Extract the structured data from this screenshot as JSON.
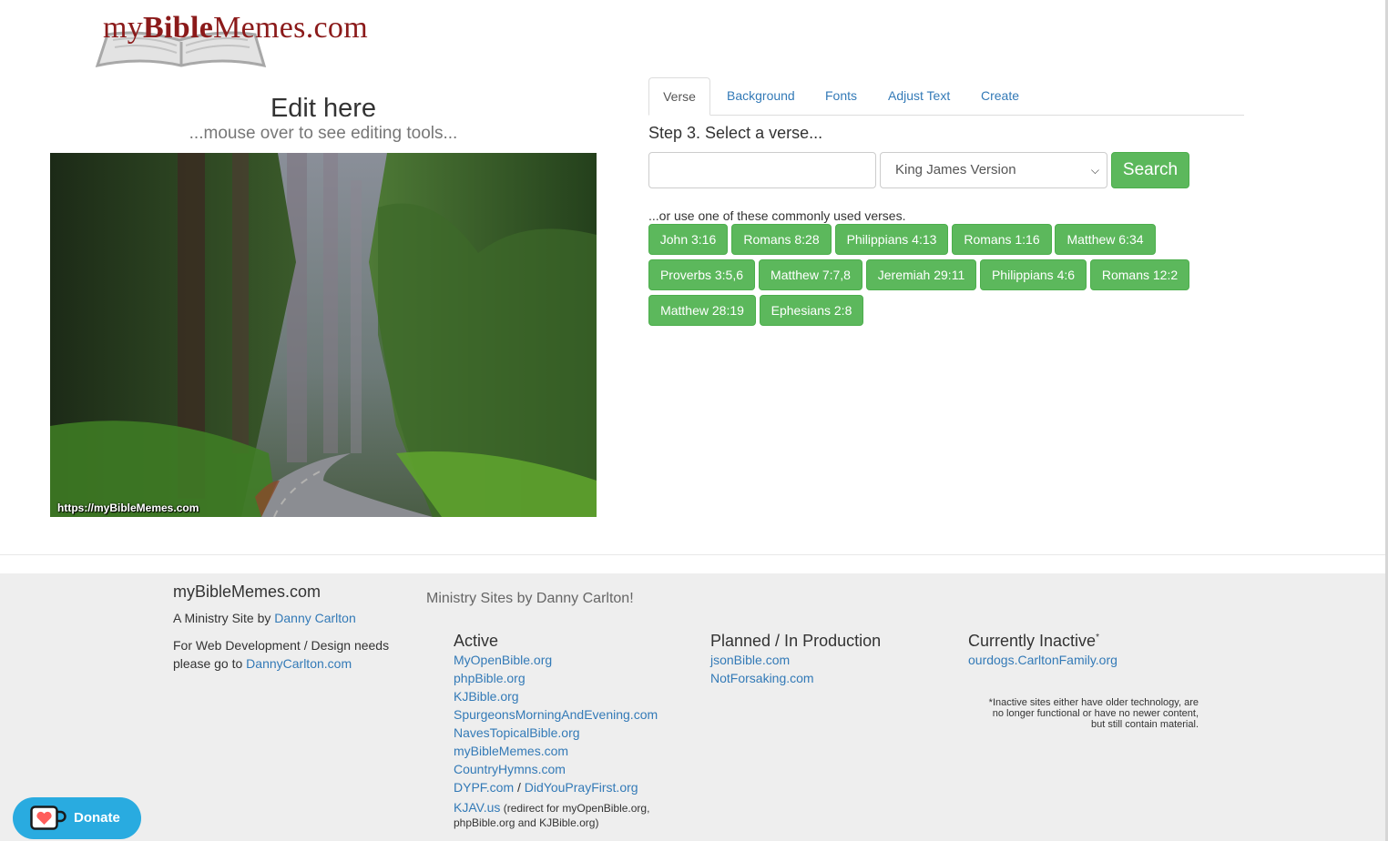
{
  "logo": {
    "prefix": "my",
    "bold": "Bible",
    "suffix": "Memes.com"
  },
  "editor": {
    "title": "Edit here",
    "subtitle": "...mouse over to see editing tools...",
    "watermark": "https://myBibleMemes.com"
  },
  "tabs": [
    {
      "label": "Verse",
      "active": true
    },
    {
      "label": "Background"
    },
    {
      "label": "Fonts"
    },
    {
      "label": "Adjust Text"
    },
    {
      "label": "Create"
    }
  ],
  "verse_panel": {
    "step_label": "Step 3. Select a verse...",
    "input_value": "",
    "version_selected": "King James Version",
    "search_label": "Search",
    "common_label": "...or use one of these commonly used verses.",
    "verses": [
      "John 3:16",
      "Romans 8:28",
      "Philippians 4:13",
      "Romans 1:16",
      "Matthew 6:34",
      "Proverbs 3:5,6",
      "Matthew 7:7,8",
      "Jeremiah 29:11",
      "Philippians 4:6",
      "Romans 12:2",
      "Matthew 28:19",
      "Ephesians 2:8"
    ],
    "button_color": "#5cb85c"
  },
  "footer": {
    "site_title": "myBibleMemes.com",
    "ministry_prefix": "A Ministry Site by ",
    "ministry_link": "Danny Carlton",
    "webdev_text": "For Web Development / Design needs please go to ",
    "webdev_link": "DannyCarlton.com",
    "ministry_sites_heading": "Ministry Sites by Danny Carlton!",
    "active_heading": "Active",
    "active_links": [
      "MyOpenBible.org",
      "phpBible.org",
      "KJBible.org",
      "SpurgeonsMorningAndEvening.com",
      "NavesTopicalBible.org",
      "myBibleMemes.com",
      "CountryHymns.com"
    ],
    "dypf_link": "DYPF.com",
    "dypf_sep": " / ",
    "didyoupray_link": "DidYouPrayFirst.org",
    "kjav_link": "KJAV.us",
    "kjav_note": " (redirect for myOpenBible.org, phpBible.org and KJBible.org)",
    "planned_heading": "Planned / In Production",
    "planned_links": [
      "jsonBible.com",
      "NotForsaking.com"
    ],
    "inactive_heading": "Currently Inactive",
    "inactive_mark": "*",
    "inactive_links": [
      "ourdogs.CarltonFamily.org"
    ],
    "inactive_note": "*Inactive sites either have older technology, are no longer functional or have no newer content, but still contain material."
  },
  "donate": {
    "label": "Donate",
    "icon": "heart-cup-icon",
    "color": "#29abe0"
  }
}
